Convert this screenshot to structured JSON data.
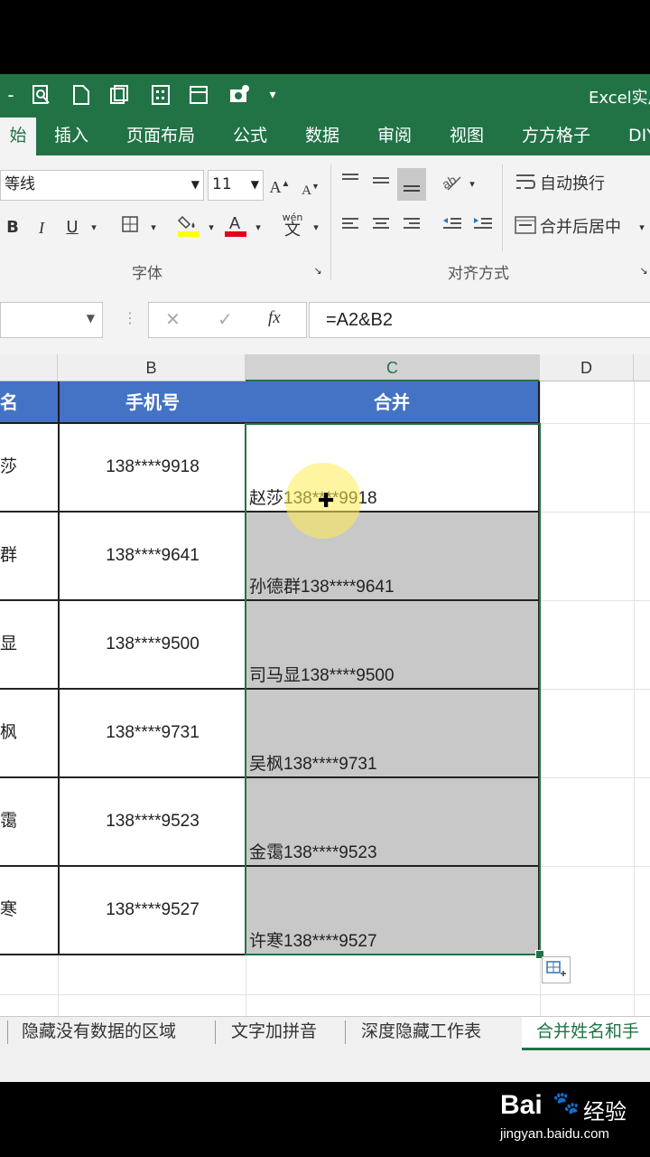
{
  "window": {
    "app_title": "Excel实周",
    "qat_icons": [
      "minimize-icon",
      "print-preview-icon",
      "new-file-icon",
      "copy-format-icon",
      "calculator-icon",
      "window-icon",
      "camera-icon",
      "customize-qat-icon"
    ]
  },
  "ribbon": {
    "tabs": [
      "始",
      "插入",
      "页面布局",
      "公式",
      "数据",
      "审阅",
      "视图",
      "方方格子",
      "DIY"
    ],
    "active_tab_index": 0,
    "font": {
      "name": "等线",
      "size": "11",
      "grow": "A",
      "shrink": "A",
      "bold": "B",
      "italic": "I",
      "underline": "U",
      "pinyin": "wén"
    },
    "groups": {
      "font": "字体",
      "alignment": "对齐方式"
    },
    "wrap_text": "自动换行",
    "merge_center": "合并后居中"
  },
  "formula_bar": {
    "cancel": "✕",
    "enter": "✓",
    "fx": "fx",
    "formula": "=A2&B2"
  },
  "grid": {
    "col_headers": [
      "B",
      "C",
      "D"
    ],
    "header_row": {
      "a": "名",
      "b": "手机号",
      "c": "合并"
    },
    "rows": [
      {
        "a": "莎",
        "b": "138****9918",
        "c": "赵莎138****9918"
      },
      {
        "a": "群",
        "b": "138****9641",
        "c": "孙德群138****9641"
      },
      {
        "a": "显",
        "b": "138****9500",
        "c": "司马显138****9500"
      },
      {
        "a": "枫",
        "b": "138****9731",
        "c": "吴枫138****9731"
      },
      {
        "a": "霭",
        "b": "138****9523",
        "c": "金霭138****9523"
      },
      {
        "a": "寒",
        "b": "138****9527",
        "c": "许寒138****9527"
      }
    ]
  },
  "sheet_tabs": [
    "隐藏没有数据的区域",
    "文字加拼音",
    "深度隐藏工作表",
    "合并姓名和手"
  ],
  "active_sheet_index": 3,
  "watermark": {
    "brand": "Bai",
    "brand2": "经验",
    "url": "jingyan.baidu.com"
  },
  "colors": {
    "excel_green": "#217346",
    "header_blue": "#4472c4",
    "selection_gray": "#c8c8c8"
  }
}
